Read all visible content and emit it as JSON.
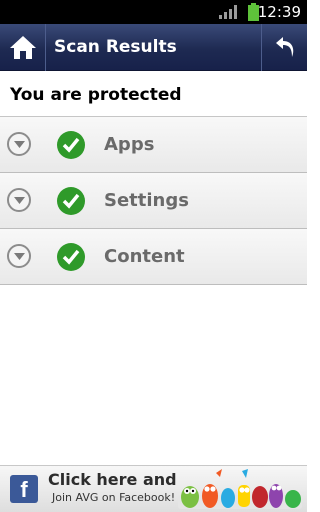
{
  "status_bar": {
    "time": "12:39",
    "battery_color": "#5ec23a"
  },
  "header": {
    "title": "Scan Results",
    "background": "#1e2a52",
    "home_icon": "home-icon",
    "back_icon": "back-arrow-icon"
  },
  "status_message": "You are protected",
  "results": [
    {
      "label": "Apps",
      "status": "ok"
    },
    {
      "label": "Settings",
      "status": "ok"
    },
    {
      "label": "Content",
      "status": "ok"
    }
  ],
  "check_color": "#2f9a2a",
  "banner": {
    "main": "Click here and",
    "sub": "Join AVG on Facebook!",
    "logo": "f"
  }
}
